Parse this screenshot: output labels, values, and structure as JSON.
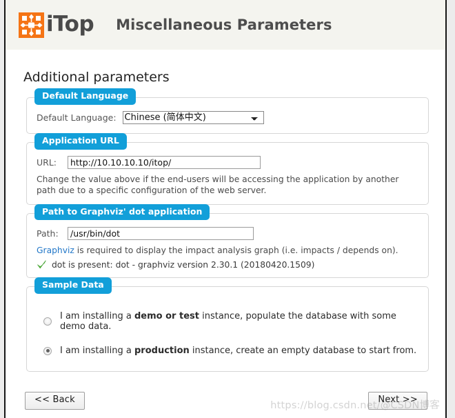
{
  "header": {
    "logo_word": "iTop",
    "logo_icon": "itop-network-logo-icon",
    "title": "Miscellaneous Parameters"
  },
  "main": {
    "section_title": "Additional parameters"
  },
  "language_section": {
    "legend": "Default Language",
    "field_label": "Default Language:",
    "selected_option": "Chinese (简体中文)",
    "options": [
      "Chinese (简体中文)"
    ]
  },
  "url_section": {
    "legend": "Application URL",
    "field_label": "URL:",
    "value": "http://10.10.10.10/itop/",
    "placeholder": "",
    "help": "Change the value above if the end-users will be accessing the application by another path due to a specific configuration of the web server."
  },
  "graphviz_section": {
    "legend": "Path to Graphviz' dot application",
    "field_label": "Path:",
    "value": "/usr/bin/dot",
    "placeholder": "",
    "help_link": "Graphviz",
    "help_rest": " is required to display the impact analysis graph (i.e. impacts / depends on).",
    "status_icon": "green-check-icon",
    "status_text": "dot is present: dot - graphviz version 2.30.1 (20180420.1509)"
  },
  "sample_section": {
    "legend": "Sample Data",
    "options": [
      {
        "id": "demo",
        "checked": false,
        "pre": "I am installing a ",
        "strong": "demo or test",
        "post": " instance, populate the database with some demo data."
      },
      {
        "id": "production",
        "checked": true,
        "pre": "I am installing a ",
        "strong": "production",
        "post": " instance, create an empty database to start from."
      }
    ]
  },
  "footer": {
    "back_label": "<< Back",
    "next_label": "Next >>"
  },
  "watermark": {
    "text": "https://blog.csdn.net/@CSDN博客"
  },
  "colors": {
    "accent_blue": "#129fd9",
    "logo_orange": "#f57415",
    "link_blue": "#2277c8",
    "header_bg": "#f4f4ef",
    "status_green": "#55b840"
  }
}
